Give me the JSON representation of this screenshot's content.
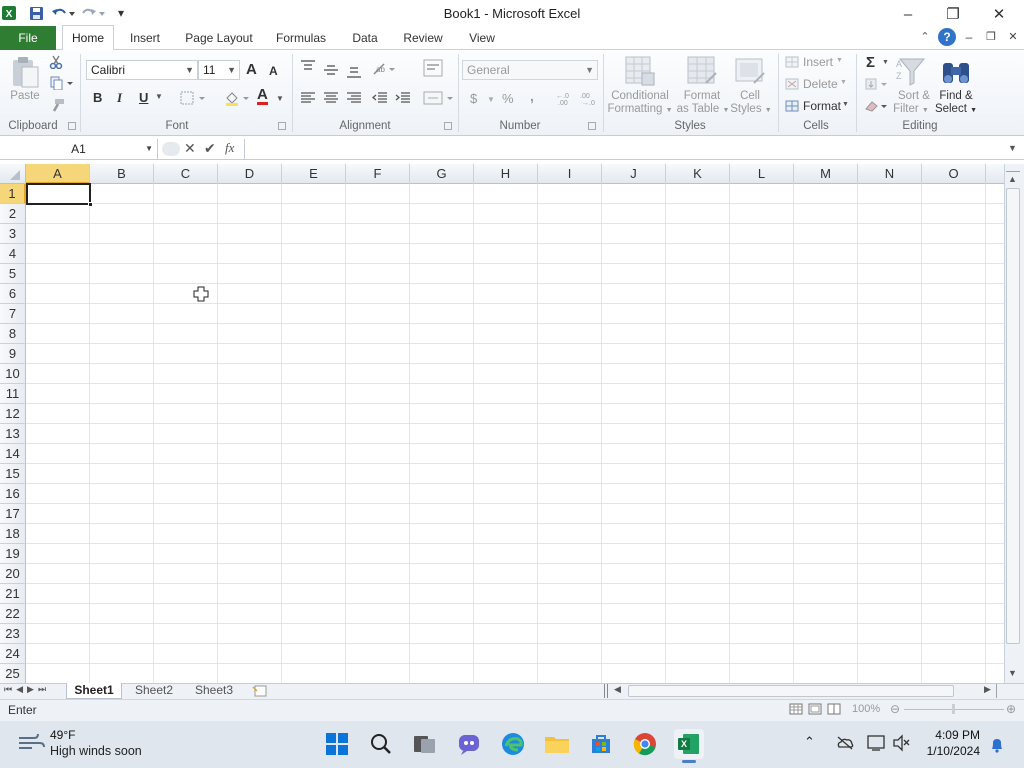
{
  "window": {
    "title": "Book1  -  Microsoft Excel",
    "minimize": "–",
    "restore": "❐",
    "close": "✕"
  },
  "quick_access": {
    "customize": "▾"
  },
  "tabs": {
    "file": "File",
    "home": "Home",
    "insert": "Insert",
    "page_layout": "Page Layout",
    "formulas": "Formulas",
    "data": "Data",
    "review": "Review",
    "view": "View"
  },
  "ribbon": {
    "clipboard": {
      "label": "Clipboard",
      "paste": "Paste"
    },
    "font": {
      "label": "Font",
      "name": "Calibri",
      "size": "11",
      "bold": "B",
      "italic": "I",
      "underline": "U",
      "grow": "A",
      "shrink": "A",
      "font_color": "A"
    },
    "alignment": {
      "label": "Alignment"
    },
    "number": {
      "label": "Number",
      "format": "General",
      "currency": "$",
      "percent": "%",
      "comma": ","
    },
    "styles": {
      "label": "Styles",
      "conditional_1": "Conditional",
      "conditional_2": "Formatting",
      "format_table_1": "Format",
      "format_table_2": "as Table",
      "cell_styles_1": "Cell",
      "cell_styles_2": "Styles"
    },
    "cells": {
      "label": "Cells",
      "insert": "Insert",
      "delete": "Delete",
      "format": "Format"
    },
    "editing": {
      "label": "Editing",
      "sum": "Σ",
      "sort_1": "Sort &",
      "sort_2": "Filter",
      "find_1": "Find &",
      "find_2": "Select"
    }
  },
  "formula_bar": {
    "name_box": "A1",
    "fx": "fx",
    "content": ""
  },
  "columns": [
    "A",
    "B",
    "C",
    "D",
    "E",
    "F",
    "G",
    "H",
    "I",
    "J",
    "K",
    "L",
    "M",
    "N",
    "O"
  ],
  "rows": [
    "1",
    "2",
    "3",
    "4",
    "5",
    "6",
    "7",
    "8",
    "9",
    "10",
    "11",
    "12",
    "13",
    "14",
    "15",
    "16",
    "17",
    "18",
    "19",
    "20",
    "21",
    "22",
    "23",
    "24",
    "25"
  ],
  "sheets": [
    "Sheet1",
    "Sheet2",
    "Sheet3"
  ],
  "status": {
    "mode": "Enter",
    "zoom": "100%"
  },
  "taskbar": {
    "temp": "49°F",
    "weather": "High winds soon",
    "time": "4:09 PM",
    "date": "1/10/2024"
  },
  "colors": {
    "file_tab": "#2f7d32",
    "selection": "#222222",
    "header_active": "#f5d77a"
  }
}
